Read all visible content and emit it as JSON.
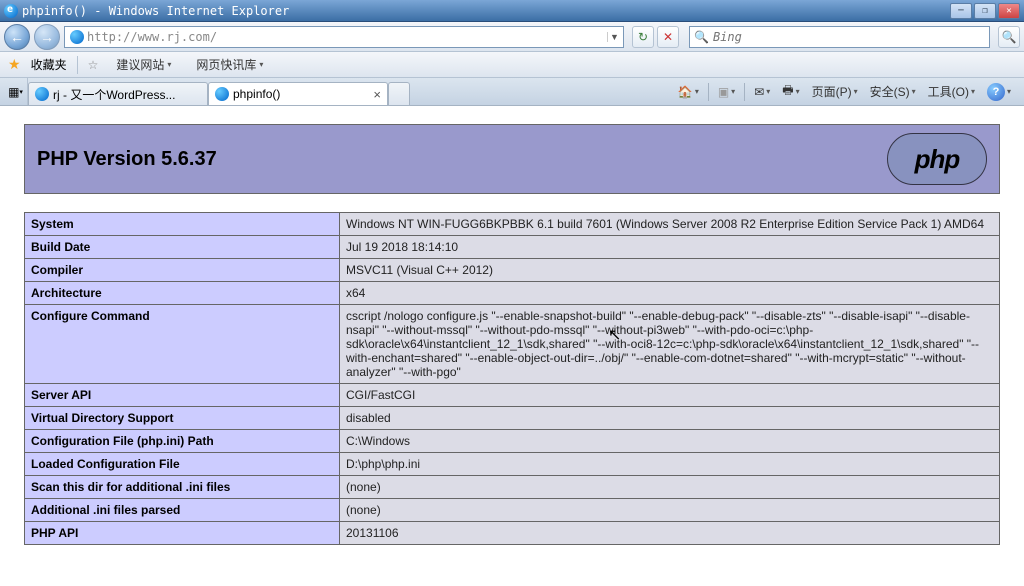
{
  "window": {
    "title": "phpinfo() - Windows Internet Explorer"
  },
  "address": {
    "url": "http://www.rj.com/"
  },
  "favorites": {
    "label": "收藏夹",
    "link1": "建议网站",
    "link2": "网页快讯库"
  },
  "tabs": [
    {
      "label": "rj - 又一个WordPress...",
      "active": false
    },
    {
      "label": "phpinfo()",
      "active": true
    }
  ],
  "cmdbar": {
    "page": "页面(P)",
    "safety": "安全(S)",
    "tools": "工具(O)"
  },
  "search": {
    "placeholder": "Bing"
  },
  "php": {
    "title": "PHP Version 5.6.37",
    "logo": "php",
    "rows": [
      {
        "key": "System",
        "val": "Windows NT WIN-FUGG6BKPBBK 6.1 build 7601 (Windows Server 2008 R2 Enterprise Edition Service Pack 1) AMD64"
      },
      {
        "key": "Build Date",
        "val": "Jul 19 2018 18:14:10"
      },
      {
        "key": "Compiler",
        "val": "MSVC11 (Visual C++ 2012)"
      },
      {
        "key": "Architecture",
        "val": "x64"
      },
      {
        "key": "Configure Command",
        "val": "cscript /nologo configure.js \"--enable-snapshot-build\" \"--enable-debug-pack\" \"--disable-zts\" \"--disable-isapi\" \"--disable-nsapi\" \"--without-mssql\" \"--without-pdo-mssql\" \"--without-pi3web\" \"--with-pdo-oci=c:\\php-sdk\\oracle\\x64\\instantclient_12_1\\sdk,shared\" \"--with-oci8-12c=c:\\php-sdk\\oracle\\x64\\instantclient_12_1\\sdk,shared\" \"--with-enchant=shared\" \"--enable-object-out-dir=../obj/\" \"--enable-com-dotnet=shared\" \"--with-mcrypt=static\" \"--without-analyzer\" \"--with-pgo\""
      },
      {
        "key": "Server API",
        "val": "CGI/FastCGI"
      },
      {
        "key": "Virtual Directory Support",
        "val": "disabled"
      },
      {
        "key": "Configuration File (php.ini) Path",
        "val": "C:\\Windows"
      },
      {
        "key": "Loaded Configuration File",
        "val": "D:\\php\\php.ini"
      },
      {
        "key": "Scan this dir for additional .ini files",
        "val": "(none)"
      },
      {
        "key": "Additional .ini files parsed",
        "val": "(none)"
      },
      {
        "key": "PHP API",
        "val": "20131106"
      }
    ]
  }
}
